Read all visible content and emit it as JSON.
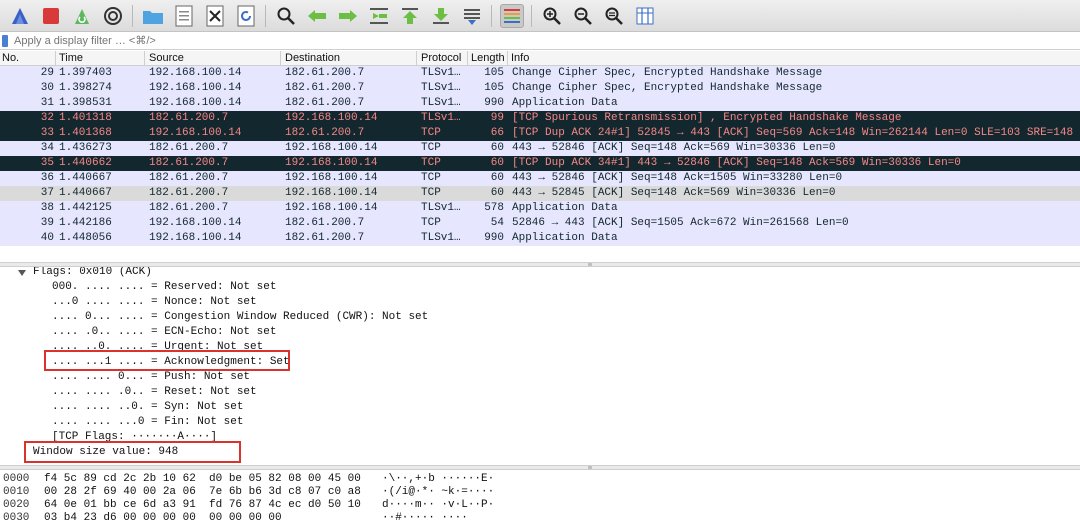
{
  "toolbar": {
    "buttons": [
      "shark-fin-icon",
      "stop-icon",
      "restart-icon",
      "options-gear-icon",
      "open-folder-icon",
      "save-file-icon",
      "close-file-icon",
      "reload-icon",
      "find-packet-icon",
      "go-back-icon",
      "go-forward-icon",
      "go-to-packet-icon",
      "go-first-icon",
      "go-last-icon",
      "autoscroll-icon",
      "colorize-icon",
      "zoom-in-icon",
      "zoom-out-icon",
      "zoom-reset-icon",
      "resize-columns-icon"
    ]
  },
  "filter": {
    "placeholder": "Apply a display filter … <⌘/>"
  },
  "packet_list": {
    "columns": [
      "No.",
      "Time",
      "Source",
      "Destination",
      "Protocol",
      "Length",
      "Info"
    ],
    "rows": [
      {
        "no": "29",
        "time": "1.397403",
        "src": "192.168.100.14",
        "dst": "182.61.200.7",
        "proto": "TLSv1…",
        "len": "105",
        "info": "Change Cipher Spec, Encrypted Handshake Message",
        "style": "lav"
      },
      {
        "no": "30",
        "time": "1.398274",
        "src": "192.168.100.14",
        "dst": "182.61.200.7",
        "proto": "TLSv1…",
        "len": "105",
        "info": "Change Cipher Spec, Encrypted Handshake Message",
        "style": "lav"
      },
      {
        "no": "31",
        "time": "1.398531",
        "src": "192.168.100.14",
        "dst": "182.61.200.7",
        "proto": "TLSv1…",
        "len": "990",
        "info": "Application Data",
        "style": "lav"
      },
      {
        "no": "32",
        "time": "1.401318",
        "src": "182.61.200.7",
        "dst": "192.168.100.14",
        "proto": "TLSv1…",
        "len": "99",
        "info": "[TCP Spurious Retransmission] , Encrypted Handshake Message",
        "style": "dark"
      },
      {
        "no": "33",
        "time": "1.401368",
        "src": "192.168.100.14",
        "dst": "182.61.200.7",
        "proto": "TCP",
        "len": "66",
        "info": "[TCP Dup ACK 24#1] 52845 → 443 [ACK] Seq=569 Ack=148 Win=262144 Len=0 SLE=103 SRE=148",
        "style": "dark"
      },
      {
        "no": "34",
        "time": "1.436273",
        "src": "182.61.200.7",
        "dst": "192.168.100.14",
        "proto": "TCP",
        "len": "60",
        "info": "443 → 52846 [ACK] Seq=148 Ack=569 Win=30336 Len=0",
        "style": "lav"
      },
      {
        "no": "35",
        "time": "1.440662",
        "src": "182.61.200.7",
        "dst": "192.168.100.14",
        "proto": "TCP",
        "len": "60",
        "info": "[TCP Dup ACK 34#1] 443 → 52846 [ACK] Seq=148 Ack=569 Win=30336 Len=0",
        "style": "dark"
      },
      {
        "no": "36",
        "time": "1.440667",
        "src": "182.61.200.7",
        "dst": "192.168.100.14",
        "proto": "TCP",
        "len": "60",
        "info": "443 → 52846 [ACK] Seq=148 Ack=1505 Win=33280 Len=0",
        "style": "lav"
      },
      {
        "no": "37",
        "time": "1.440667",
        "src": "182.61.200.7",
        "dst": "192.168.100.14",
        "proto": "TCP",
        "len": "60",
        "info": "443 → 52845 [ACK] Seq=148 Ack=569 Win=30336 Len=0",
        "style": "gray"
      },
      {
        "no": "38",
        "time": "1.442125",
        "src": "182.61.200.7",
        "dst": "192.168.100.14",
        "proto": "TLSv1…",
        "len": "578",
        "info": "Application Data",
        "style": "lav"
      },
      {
        "no": "39",
        "time": "1.442186",
        "src": "192.168.100.14",
        "dst": "182.61.200.7",
        "proto": "TCP",
        "len": "54",
        "info": "52846 → 443 [ACK] Seq=1505 Ack=672 Win=261568 Len=0",
        "style": "lav"
      },
      {
        "no": "40",
        "time": "1.448056",
        "src": "192.168.100.14",
        "dst": "182.61.200.7",
        "proto": "TLSv1…",
        "len": "990",
        "info": "Application Data",
        "style": "lav"
      }
    ]
  },
  "details": {
    "flags_header": "Flags: 0x010 (ACK)",
    "lines": [
      "000. .... .... = Reserved: Not set",
      "...0 .... .... = Nonce: Not set",
      ".... 0... .... = Congestion Window Reduced (CWR): Not set",
      ".... .0.. .... = ECN-Echo: Not set",
      ".... ..0. .... = Urgent: Not set",
      ".... ...1 .... = Acknowledgment: Set",
      ".... .... 0... = Push: Not set",
      ".... .... .0.. = Reset: Not set",
      ".... .... ..0. = Syn: Not set",
      ".... .... ...0 = Fin: Not set",
      "[TCP Flags: ·······A····]"
    ],
    "window_size": "Window size value: 948"
  },
  "bytes": {
    "rows": [
      {
        "offset": "0000",
        "hex": "f4 5c 89 cd 2c 2b 10 62  d0 be 05 82 08 00 45 00",
        "ascii": "·\\··,+·b ······E·"
      },
      {
        "offset": "0010",
        "hex": "00 28 2f 69 40 00 2a 06  7e 6b b6 3d c8 07 c0 a8",
        "ascii": "·(/i@·*· ~k·=····"
      },
      {
        "offset": "0020",
        "hex": "64 0e 01 bb ce 6d a3 91  fd 76 87 4c ec d0 50 10",
        "ascii": "d····m·· ·v·L··P·"
      },
      {
        "offset": "0030",
        "hex": "03 b4 23 d6 00 00 00 00  00 00 00 00",
        "ascii": "··#····· ····"
      }
    ]
  },
  "colors": {
    "row_lavender": "#e7e6ff",
    "row_dark": "#12272e",
    "row_dark_text": "#f78787",
    "row_gray": "#dadada",
    "highlight_box": "#d9342b"
  }
}
